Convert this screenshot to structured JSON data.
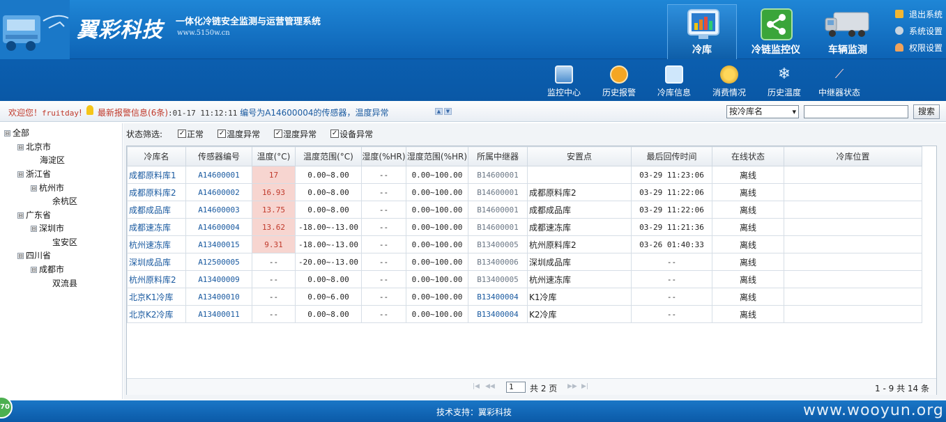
{
  "brand": {
    "logo": "翼彩科技",
    "slogan": "一体化冷链安全监测与运营管理系统",
    "url": "www.5150w.cn"
  },
  "main_tabs": [
    {
      "label": "冷库",
      "icon": "cold-storage-monitor-icon",
      "active": true
    },
    {
      "label": "冷链监控仪",
      "icon": "share-icon",
      "active": false
    },
    {
      "label": "车辆监测",
      "icon": "truck-icon",
      "active": false
    }
  ],
  "top_links": [
    {
      "label": "退出系统",
      "icon": "lock-icon"
    },
    {
      "label": "系统设置",
      "icon": "gear-icon"
    },
    {
      "label": "权限设置",
      "icon": "user-icon"
    }
  ],
  "sub_nav": [
    {
      "label": "监控中心",
      "icon": "monitor-icon"
    },
    {
      "label": "历史报警",
      "icon": "alarm-clock-icon"
    },
    {
      "label": "冷库信息",
      "icon": "message-icon"
    },
    {
      "label": "消费情况",
      "icon": "coins-icon"
    },
    {
      "label": "历史温度",
      "icon": "snowflake-icon"
    },
    {
      "label": "中继器状态",
      "icon": "signal-icon"
    }
  ],
  "info_bar": {
    "welcome": "欢迎您！",
    "user": "fruitday",
    "alarm_label": "最新报警信息",
    "alarm_count": "(6条)",
    "alarm_time": ":01-17 11:12:11",
    "alarm_msg": "编号为A14600004的传感器，温度异常",
    "search_mode": "按冷库名",
    "search_value": "",
    "search_button": "搜索"
  },
  "tree": [
    {
      "label": "全部",
      "toggle": "⊟",
      "level": 0
    },
    {
      "label": "北京市",
      "toggle": "⊟",
      "level": 1
    },
    {
      "label": "海淀区",
      "toggle": "",
      "level": 2
    },
    {
      "label": "浙江省",
      "toggle": "⊟",
      "level": 1
    },
    {
      "label": "杭州市",
      "toggle": "⊟",
      "level": 2
    },
    {
      "label": "余杭区",
      "toggle": "",
      "level": 3
    },
    {
      "label": "广东省",
      "toggle": "⊟",
      "level": 1
    },
    {
      "label": "深圳市",
      "toggle": "⊟",
      "level": 2
    },
    {
      "label": "宝安区",
      "toggle": "",
      "level": 3
    },
    {
      "label": "四川省",
      "toggle": "⊟",
      "level": 1
    },
    {
      "label": "成都市",
      "toggle": "⊟",
      "level": 2
    },
    {
      "label": "双流县",
      "toggle": "",
      "level": 3
    }
  ],
  "filter": {
    "label": "状态筛选:",
    "options": [
      {
        "label": "正常",
        "checked": true
      },
      {
        "label": "温度异常",
        "checked": true
      },
      {
        "label": "湿度异常",
        "checked": true
      },
      {
        "label": "设备异常",
        "checked": true
      }
    ]
  },
  "table": {
    "columns": [
      "冷库名",
      "传感器编号",
      "温度(°C)",
      "温度范围(°C)",
      "湿度(%HR)",
      "湿度范围(%HR)",
      "所属中继器",
      "安置点",
      "最后回传时间",
      "在线状态",
      "冷库位置"
    ],
    "rows": [
      {
        "name": "成都原料库1",
        "sensor": "A14600001",
        "temp": "17",
        "temp_range": "0.00~8.00",
        "hum": "--",
        "hum_range": "0.00~100.00",
        "relay": "B14600001",
        "relay_hl": false,
        "place": "",
        "last": "03-29 11:23:06",
        "status": "离线",
        "location": ""
      },
      {
        "name": "成都原料库2",
        "sensor": "A14600002",
        "temp": "16.93",
        "temp_range": "0.00~8.00",
        "hum": "--",
        "hum_range": "0.00~100.00",
        "relay": "B14600001",
        "relay_hl": false,
        "place": "成都原料库2",
        "last": "03-29 11:22:06",
        "status": "离线",
        "location": ""
      },
      {
        "name": "成都成品库",
        "sensor": "A14600003",
        "temp": "13.75",
        "temp_range": "0.00~8.00",
        "hum": "--",
        "hum_range": "0.00~100.00",
        "relay": "B14600001",
        "relay_hl": false,
        "place": "成都成品库",
        "last": "03-29 11:22:06",
        "status": "离线",
        "location": ""
      },
      {
        "name": "成都速冻库",
        "sensor": "A14600004",
        "temp": "13.62",
        "temp_range": "-18.00~-13.00",
        "hum": "--",
        "hum_range": "0.00~100.00",
        "relay": "B14600001",
        "relay_hl": false,
        "place": "成都速冻库",
        "last": "03-29 11:21:36",
        "status": "离线",
        "location": ""
      },
      {
        "name": "杭州速冻库",
        "sensor": "A13400015",
        "temp": "9.31",
        "temp_range": "-18.00~-13.00",
        "hum": "--",
        "hum_range": "0.00~100.00",
        "relay": "B13400005",
        "relay_hl": false,
        "place": "杭州原料库2",
        "last": "03-26 01:40:33",
        "status": "离线",
        "location": ""
      },
      {
        "name": "深圳成品库",
        "sensor": "A12500005",
        "temp": "--",
        "temp_range": "-20.00~-13.00",
        "hum": "--",
        "hum_range": "0.00~100.00",
        "relay": "B13400006",
        "relay_hl": false,
        "place": "深圳成品库",
        "last": "--",
        "status": "离线",
        "location": ""
      },
      {
        "name": "杭州原料库2",
        "sensor": "A13400009",
        "temp": "--",
        "temp_range": "0.00~8.00",
        "hum": "--",
        "hum_range": "0.00~100.00",
        "relay": "B13400005",
        "relay_hl": false,
        "place": "杭州速冻库",
        "last": "--",
        "status": "离线",
        "location": ""
      },
      {
        "name": "北京K1冷库",
        "sensor": "A13400010",
        "temp": "--",
        "temp_range": "0.00~6.00",
        "hum": "--",
        "hum_range": "0.00~100.00",
        "relay": "B13400004",
        "relay_hl": true,
        "place": "K1冷库",
        "last": "--",
        "status": "离线",
        "location": ""
      },
      {
        "name": "北京K2冷库",
        "sensor": "A13400011",
        "temp": "--",
        "temp_range": "0.00~8.00",
        "hum": "--",
        "hum_range": "0.00~100.00",
        "relay": "B13400004",
        "relay_hl": true,
        "place": "K2冷库",
        "last": "--",
        "status": "离线",
        "location": ""
      }
    ]
  },
  "pager": {
    "current_page": "1",
    "total_pages": "共 2 页",
    "range": "1 - 9  共 14 条"
  },
  "footer": {
    "text": "技术支持：翼彩科技",
    "watermark": "www.wooyun.org",
    "badge": "70"
  },
  "colors": {
    "brand_blue": "#0d63b5",
    "alarm_red": "#c0392b",
    "link_blue": "#1a5aa0",
    "temp_alert_bg": "#f7d5d0"
  }
}
